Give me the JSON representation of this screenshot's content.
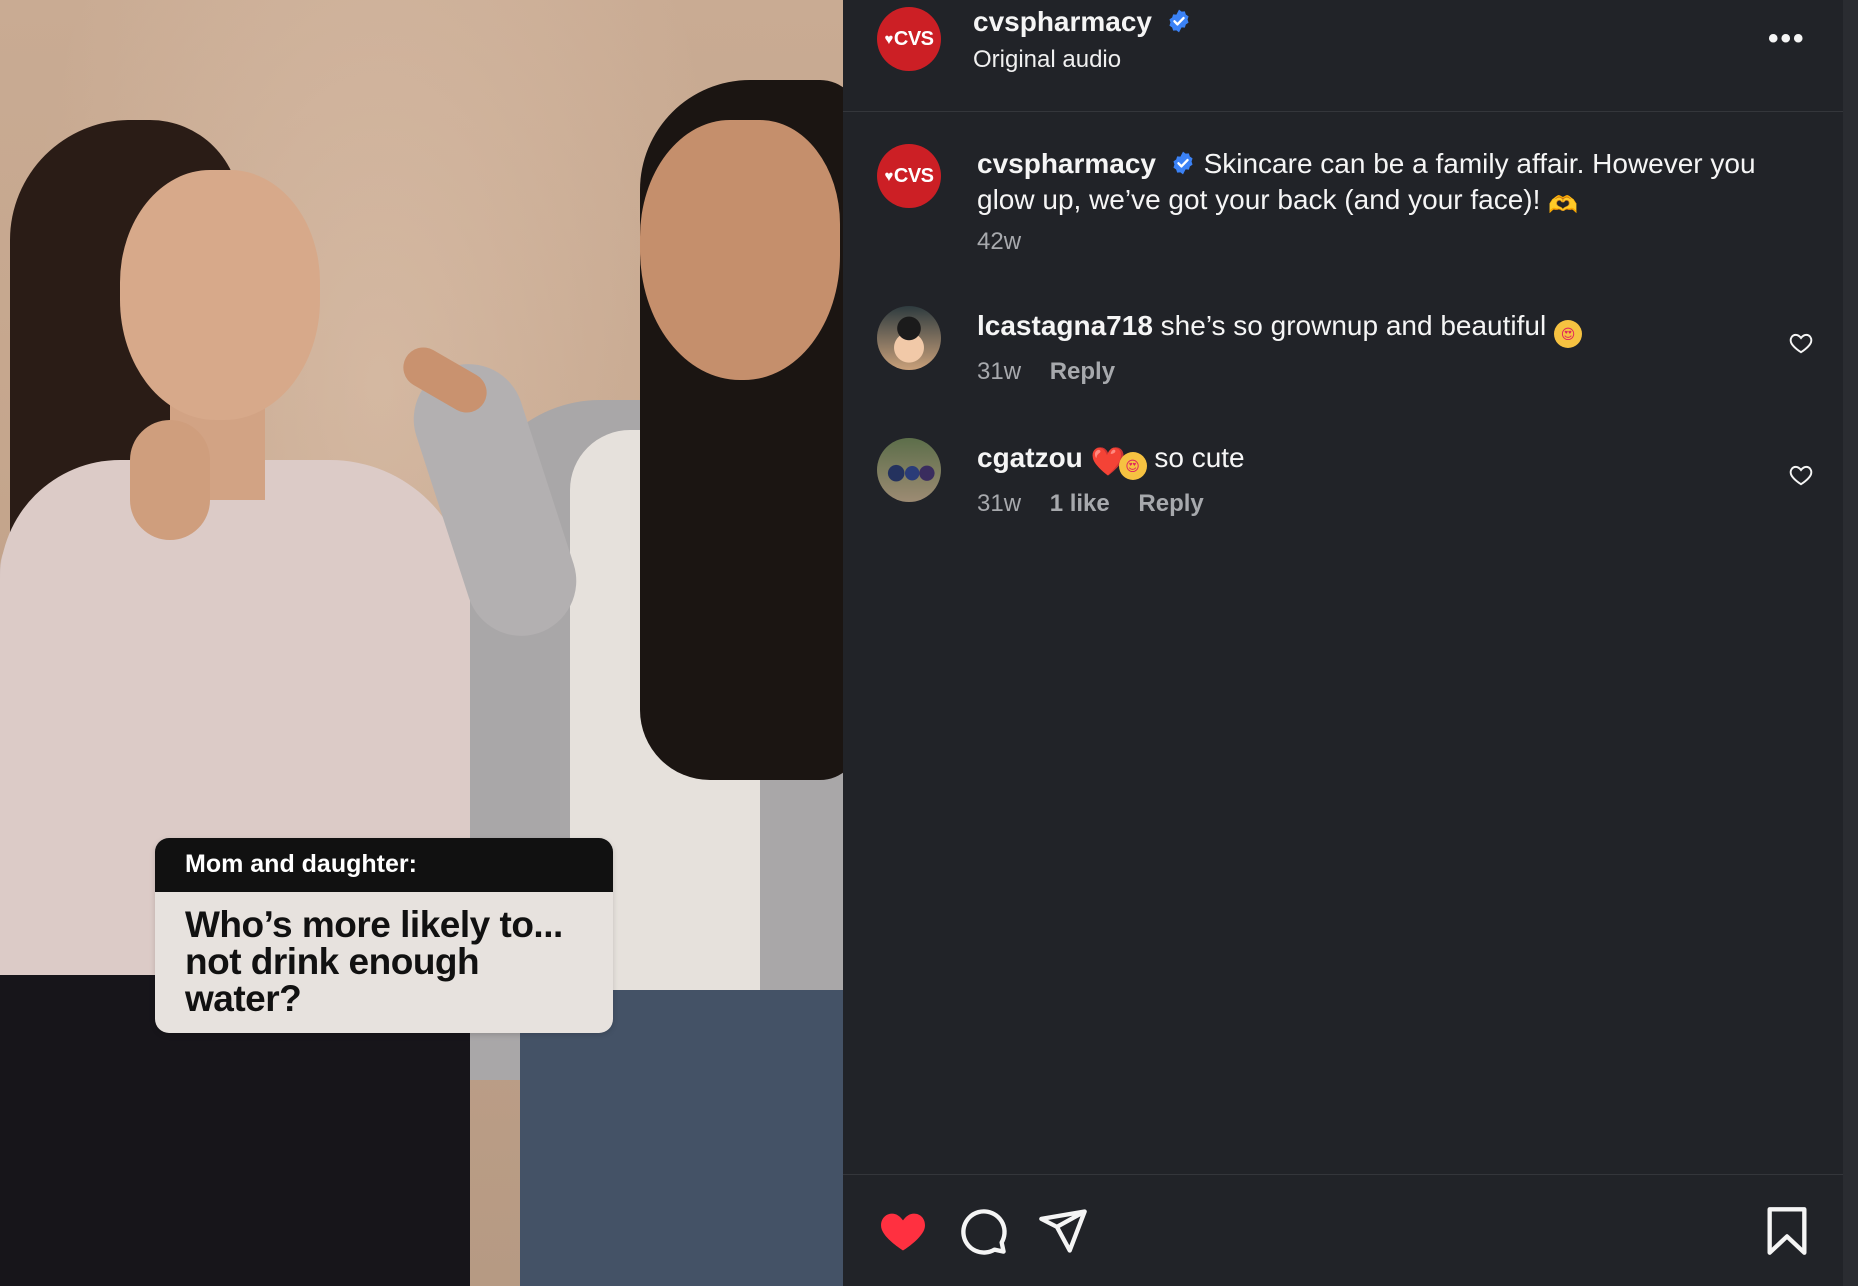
{
  "video": {
    "caption_head": "Mom and daughter:",
    "caption_body": "Who’s more likely to... not drink enough water?"
  },
  "header": {
    "avatar_text": "CVS",
    "username": "cvspharmacy",
    "subtitle": "Original audio",
    "more": "•••"
  },
  "post": {
    "avatar_text": "CVS",
    "username": "cvspharmacy",
    "text": "Skincare can be a family affair. However you glow up, we’ve got your back (and your face)!",
    "emoji": "🫶",
    "time": "42w"
  },
  "comments": [
    {
      "username": "lcastagna718",
      "text": "she’s so grownup and beautiful",
      "emoji": "😍",
      "time": "31w",
      "likes": "",
      "reply": "Reply"
    },
    {
      "username": "cgatzou",
      "emoji_prefix": "❤️",
      "emoji_prefix2": "😍",
      "text": "so cute",
      "time": "31w",
      "likes": "1 like",
      "reply": "Reply"
    }
  ],
  "colors": {
    "panel_bg": "#212328",
    "brand_red": "#cc1f25",
    "verified_blue": "#3b82f6",
    "like_red": "#ff3040",
    "meta_gray": "#a7a9ad"
  },
  "icons": [
    "verified-icon",
    "more-icon",
    "heart-icon",
    "comment-icon",
    "share-icon",
    "bookmark-icon"
  ]
}
